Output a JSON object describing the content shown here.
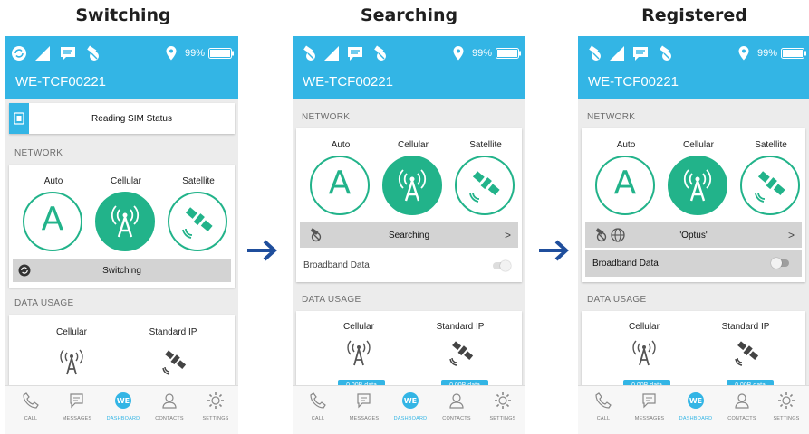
{
  "colors": {
    "accent": "#33b5e5",
    "green": "#22b38a",
    "bar": "#d3d3d3",
    "arrow": "#1f4e9c"
  },
  "panels": [
    {
      "caption": "Switching",
      "battery": "99%",
      "title": "WE-TCF00221",
      "sim_status": "Reading SIM Status",
      "network_label": "NETWORK",
      "modes": [
        "Auto",
        "Cellular",
        "Satellite"
      ],
      "selected_mode": "Cellular",
      "status_bar_text": "Switching",
      "data_usage_label": "DATA USAGE",
      "usage_cols": [
        "Cellular",
        "Standard IP"
      ]
    },
    {
      "caption": "Searching",
      "battery": "99%",
      "title": "WE-TCF00221",
      "network_label": "NETWORK",
      "modes": [
        "Auto",
        "Cellular",
        "Satellite"
      ],
      "selected_mode": "Cellular",
      "status_bar_text": "Searching",
      "broadband_label": "Broadband Data",
      "broadband_on": false,
      "data_usage_label": "DATA USAGE",
      "usage_cols": [
        "Cellular",
        "Standard IP"
      ],
      "usage_values": [
        "0.00B data",
        "0.00B data"
      ]
    },
    {
      "caption": "Registered",
      "battery": "99%",
      "title": "WE-TCF00221",
      "network_label": "NETWORK",
      "modes": [
        "Auto",
        "Cellular",
        "Satellite"
      ],
      "selected_mode": "Cellular",
      "status_bar_text": "\"Optus\"",
      "broadband_label": "Broadband Data",
      "broadband_on": false,
      "data_usage_label": "DATA USAGE",
      "usage_cols": [
        "Cellular",
        "Standard IP"
      ],
      "usage_values": [
        "0.00B data",
        "0.00B data"
      ]
    }
  ],
  "nav": [
    "CALL",
    "MESSAGES",
    "DASHBOARD",
    "CONTACTS",
    "SETTINGS"
  ],
  "nav_active": "DASHBOARD",
  "icons": {
    "status": [
      "sync-icon",
      "signal-icon",
      "message-icon",
      "no-satellite-icon",
      "location-icon",
      "battery-icon"
    ],
    "nav": [
      "phone-icon",
      "messages-icon",
      "we-dashboard-icon",
      "contacts-icon",
      "settings-gear-icon"
    ]
  }
}
